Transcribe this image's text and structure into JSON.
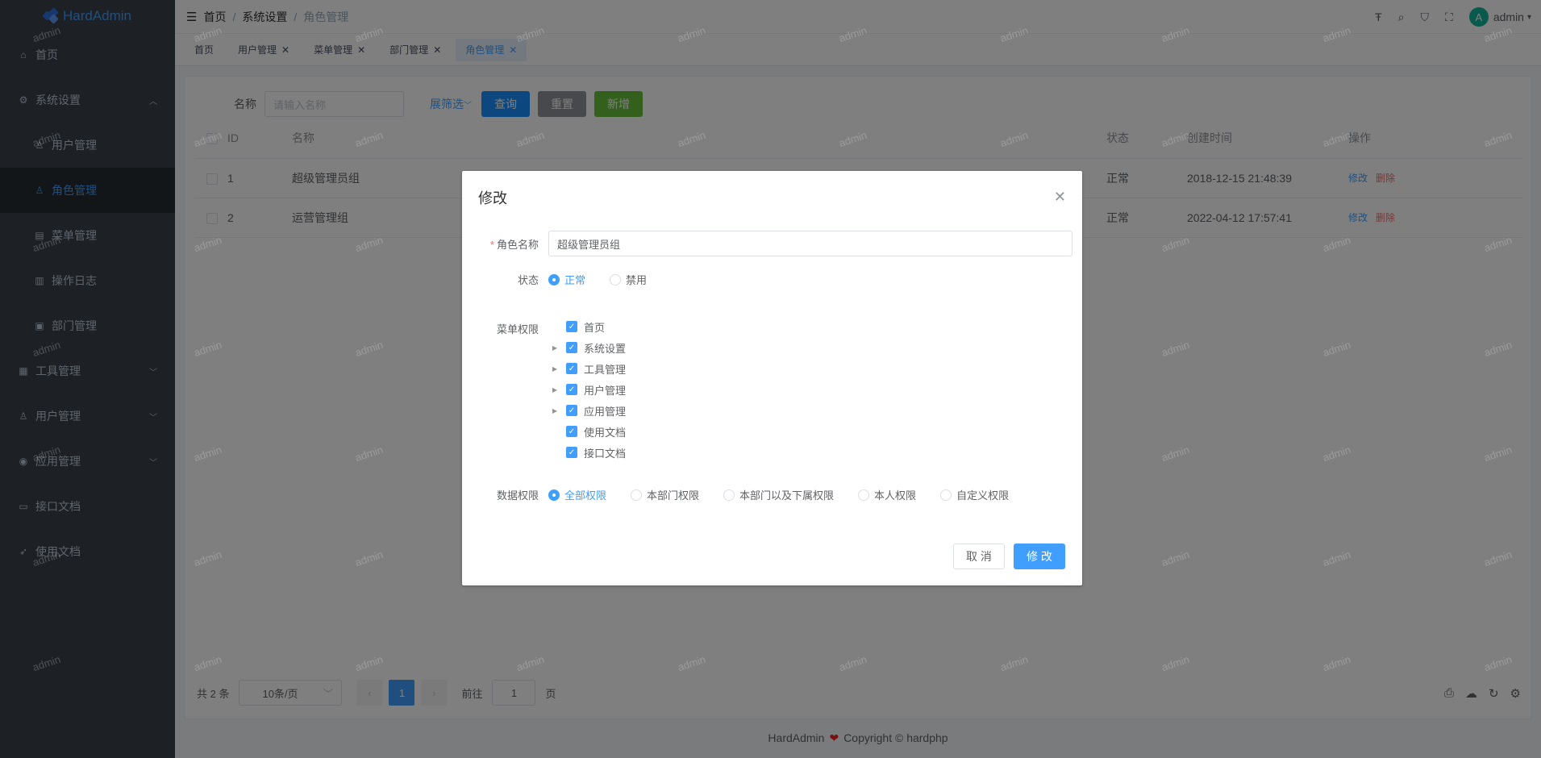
{
  "app": {
    "title": "HardAdmin"
  },
  "sidebar": {
    "items": [
      {
        "label": "首页",
        "icon": "home-icon"
      },
      {
        "label": "系统设置",
        "icon": "gear-icon",
        "expanded": true
      },
      {
        "label": "用户管理",
        "icon": "user-icon",
        "sub": true
      },
      {
        "label": "角色管理",
        "icon": "user-icon",
        "sub": true,
        "active": true
      },
      {
        "label": "菜单管理",
        "icon": "menu-icon",
        "sub": true
      },
      {
        "label": "操作日志",
        "icon": "log-icon",
        "sub": true
      },
      {
        "label": "部门管理",
        "icon": "dept-icon",
        "sub": true
      },
      {
        "label": "工具管理",
        "icon": "grid-icon",
        "collapsed": true
      },
      {
        "label": "用户管理",
        "icon": "user-icon",
        "collapsed": true
      },
      {
        "label": "应用管理",
        "icon": "broadcast-icon",
        "collapsed": true
      },
      {
        "label": "接口文档",
        "icon": "doc-icon"
      },
      {
        "label": "使用文档",
        "icon": "rocket-icon"
      }
    ]
  },
  "navbar": {
    "breadcrumb": [
      "首页",
      "系统设置",
      "角色管理"
    ],
    "user": "admin",
    "avatar_letter": "A",
    "icons": [
      "font-size-icon",
      "search-icon",
      "shirt-icon",
      "fullscreen-icon"
    ]
  },
  "tags": [
    {
      "label": "首页",
      "closable": false
    },
    {
      "label": "用户管理",
      "closable": true
    },
    {
      "label": "菜单管理",
      "closable": true
    },
    {
      "label": "部门管理",
      "closable": true
    },
    {
      "label": "角色管理",
      "closable": true,
      "active": true
    }
  ],
  "filter": {
    "name_label": "名称",
    "name_placeholder": "请输入名称",
    "expand_label": "展筛选",
    "query_button": "查询",
    "reset_button": "重置",
    "add_button": "新增"
  },
  "table": {
    "columns": [
      "ID",
      "名称",
      "状态",
      "创建时间",
      "操作"
    ],
    "rows": [
      {
        "id": "1",
        "name": "超级管理员组",
        "status": "正常",
        "created": "2018-12-15 21:48:39",
        "edit": "修改",
        "delete": "删除"
      },
      {
        "id": "2",
        "name": "运营管理组",
        "status": "正常",
        "created": "2022-04-12 17:57:41",
        "edit": "修改",
        "delete": "删除"
      }
    ]
  },
  "pager": {
    "total": "共 2 条",
    "page_size": "10条/页",
    "current": "1",
    "goto_prefix": "前往",
    "goto_value": "1",
    "goto_suffix": "页"
  },
  "footer": {
    "brand": "HardAdmin",
    "copyright": "Copyright © hardphp"
  },
  "dialog": {
    "title": "修改",
    "role_name_label": "角色名称",
    "role_name_value": "超级管理员组",
    "status_label": "状态",
    "status_options": [
      "正常",
      "禁用"
    ],
    "status_selected": "正常",
    "menu_perm_label": "菜单权限",
    "menu_tree": [
      {
        "label": "首页",
        "children": false,
        "checked": true
      },
      {
        "label": "系统设置",
        "children": true,
        "checked": true
      },
      {
        "label": "工具管理",
        "children": true,
        "checked": true
      },
      {
        "label": "用户管理",
        "children": true,
        "checked": true
      },
      {
        "label": "应用管理",
        "children": true,
        "checked": true
      },
      {
        "label": "使用文档",
        "children": false,
        "checked": true
      },
      {
        "label": "接口文档",
        "children": false,
        "checked": true
      }
    ],
    "data_perm_label": "数据权限",
    "data_perm_options": [
      "全部权限",
      "本部门权限",
      "本部门以及下属权限",
      "本人权限",
      "自定义权限"
    ],
    "data_perm_selected": "全部权限",
    "cancel_button": "取 消",
    "confirm_button": "修 改"
  },
  "watermark_text": "admin",
  "colors": {
    "primary": "#409eff",
    "sidebar_bg": "#3a414b",
    "danger": "#f56c6c",
    "success": "#67c23a"
  }
}
